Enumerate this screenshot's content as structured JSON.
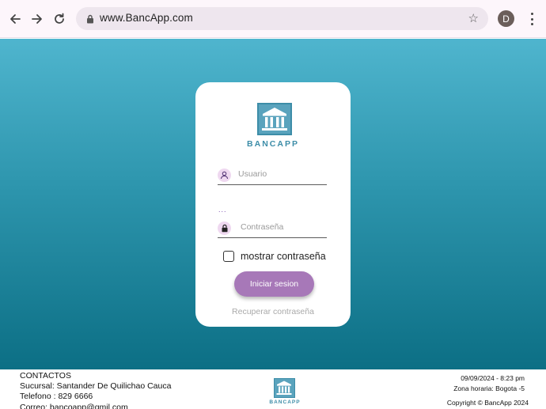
{
  "browser": {
    "url": "www.BancApp.com",
    "avatar_letter": "D"
  },
  "login": {
    "brand": "BANCAPP",
    "username_placeholder": "Usuario",
    "password_placeholder": "Contraseña",
    "password_dots": "...",
    "show_password_label": "mostrar contraseña",
    "show_password_checked": false,
    "login_button": "Iniciar sesion",
    "recover_link": "Recuperar contraseña"
  },
  "footer": {
    "contacts_title": "CONTACTOS",
    "branch": "Sucursal: Santander De Quilichao Cauca",
    "phone": "Telefono : 829 6666",
    "email": "Correo: bancoapp@gmil.com",
    "brand": "BANCAPP",
    "datetime": "09/09/2024 - 8:23 pm",
    "timezone": "Zona horaria: Bogota -5",
    "copyright": "Copyright © BancApp 2024"
  },
  "colors": {
    "accent": "#a778b8",
    "brand_blue": "#3d8da8",
    "bg_top": "#4fb5ce",
    "bg_bottom": "#0c6f85"
  }
}
